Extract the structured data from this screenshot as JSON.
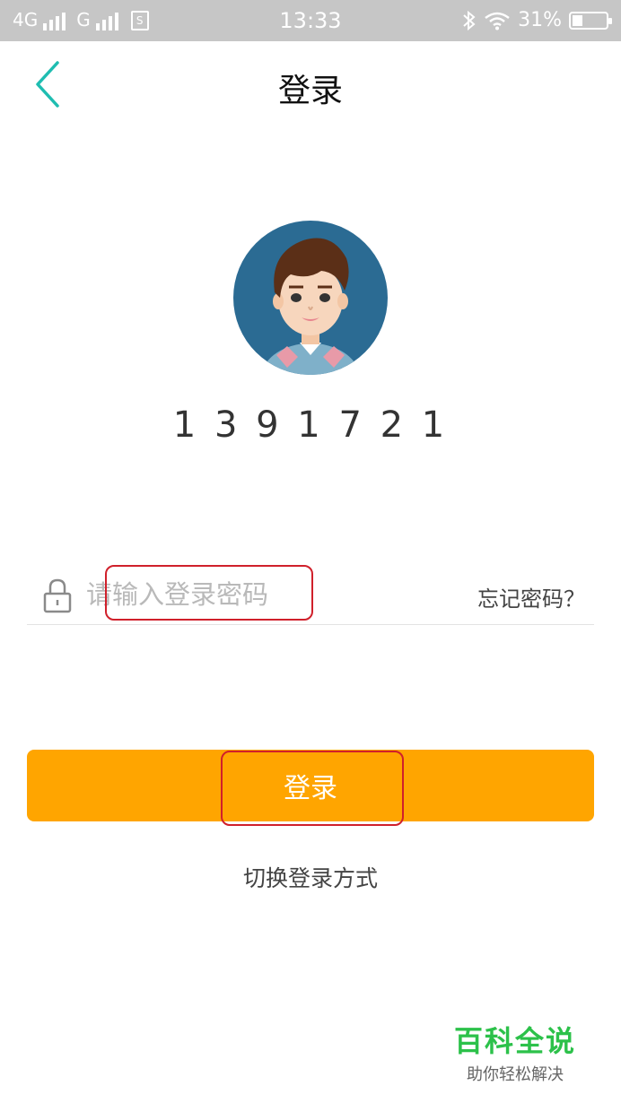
{
  "status_bar": {
    "network_1": "4G",
    "network_2": "G",
    "sim_label": "S",
    "time": "13:33",
    "battery": "31%",
    "battery_level": 0.31
  },
  "header": {
    "title": "登录"
  },
  "account": {
    "number_masked": "1 3 9  1 7 2 1"
  },
  "password_field": {
    "placeholder": "请输入登录密码",
    "value": ""
  },
  "forgot_password": "忘记密码？",
  "login_button": "登录",
  "switch_method": "切换登录方式",
  "watermark": {
    "title": "百科全说",
    "subtitle": "助你轻松解决"
  },
  "colors": {
    "accent": "#ffa500",
    "back_arrow": "#1fbdb1",
    "highlight": "#d0202b",
    "status_bar": "#c6c6c6",
    "watermark": "#2cc14a"
  }
}
